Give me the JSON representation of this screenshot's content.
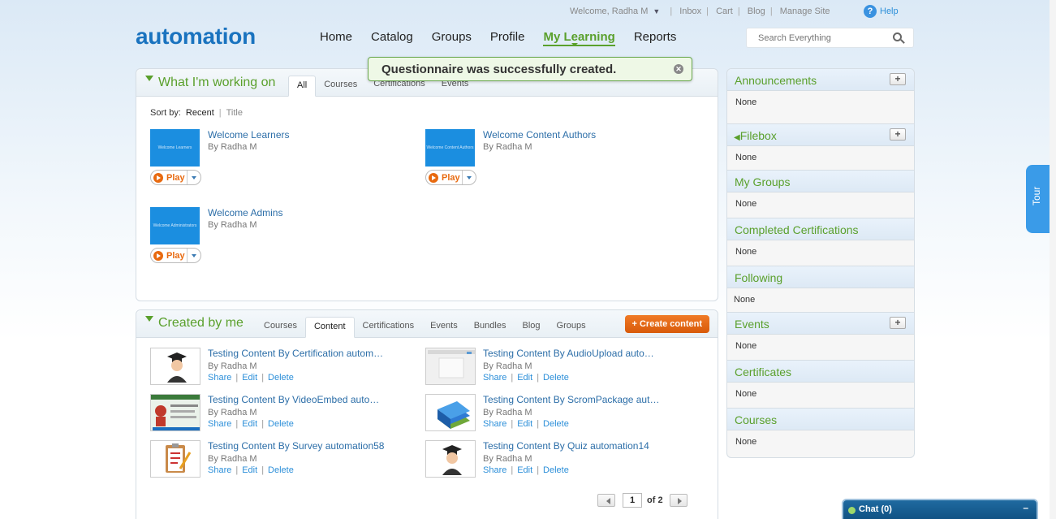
{
  "utility": {
    "welcome": "Welcome, Radha M",
    "links": [
      "Inbox",
      "Cart",
      "Blog",
      "Manage Site"
    ],
    "help": "Help"
  },
  "logo": "automation",
  "nav": [
    "Home",
    "Catalog",
    "Groups",
    "Profile",
    "My Learning",
    "Reports"
  ],
  "nav_active": "My Learning",
  "search": {
    "placeholder": "Search Everything"
  },
  "toast": {
    "message": "Questionnaire was successfully created."
  },
  "working": {
    "title": "What I'm working on",
    "tabs": [
      "All",
      "Courses",
      "Certifications",
      "Events"
    ],
    "active_tab": "All",
    "sort_label": "Sort by:",
    "sort_current": "Recent",
    "sort_other": "Title",
    "cards": [
      {
        "title": "Welcome Learners",
        "by": "By Radha M",
        "thumb_text": "Welcome Learners",
        "play": "Play"
      },
      {
        "title": "Welcome Content Authors",
        "by": "By Radha M",
        "thumb_text": "Welcome Content Authors",
        "play": "Play"
      },
      {
        "title": "Welcome Admins",
        "by": "By Radha M",
        "thumb_text": "Welcome Administrators",
        "play": "Play"
      }
    ]
  },
  "created": {
    "title": "Created by me",
    "tabs": [
      "Courses",
      "Content",
      "Certifications",
      "Events",
      "Bundles",
      "Blog",
      "Groups"
    ],
    "active_tab": "Content",
    "create_button": "+ Create content",
    "actions": {
      "share": "Share",
      "edit": "Edit",
      "delete": "Delete"
    },
    "items": [
      {
        "title": "Testing Content By Certification autom…",
        "by": "By Radha M",
        "thumb": "graduate-icon"
      },
      {
        "title": "Testing Content By AudioUpload auto…",
        "by": "By Radha M",
        "thumb": "screenshot-thumb"
      },
      {
        "title": "Testing Content By VideoEmbed auto…",
        "by": "By Radha M",
        "thumb": "video-thumb"
      },
      {
        "title": "Testing Content By ScromPackage aut…",
        "by": "By Radha M",
        "thumb": "books-icon"
      },
      {
        "title": "Testing Content By Survey automation58",
        "by": "By Radha M",
        "thumb": "clipboard-icon"
      },
      {
        "title": "Testing Content By Quiz automation14",
        "by": "By Radha M",
        "thumb": "graduate-icon"
      }
    ],
    "pager": {
      "page": "1",
      "of_label": "of 2"
    }
  },
  "sidebar": [
    {
      "title": "Announcements",
      "body": "None",
      "plus": true
    },
    {
      "title": "Filebox",
      "body": "None",
      "plus": true
    },
    {
      "title": "My Groups",
      "body": "None",
      "plus": false
    },
    {
      "title": "Completed Certifications",
      "body": "None",
      "plus": false
    },
    {
      "title": "Following",
      "body": "None",
      "plus": false
    },
    {
      "title": "Events",
      "body": "None",
      "plus": true
    },
    {
      "title": "Certificates",
      "body": "None",
      "plus": false
    },
    {
      "title": "Courses",
      "body": "None",
      "plus": false
    }
  ],
  "tour": "Tour",
  "chat": {
    "label": "Chat  (0)",
    "minimize": "–"
  },
  "colors": {
    "accent_green": "#5aa02c",
    "brand_blue": "#1a73bf",
    "create_orange": "#e86a10"
  }
}
